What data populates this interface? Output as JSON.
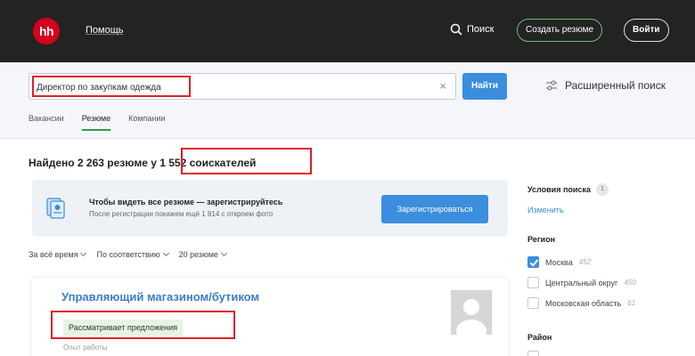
{
  "header": {
    "logo_text": "hh",
    "help_link": "Помощь",
    "search_link": "Поиск",
    "create_resume": "Создать резюме",
    "login": "Войти"
  },
  "search": {
    "query": "Директор по закупкам одежда",
    "find_button": "Найти",
    "advanced": "Расширенный поиск"
  },
  "tabs": [
    {
      "label": "Вакансии",
      "active": false
    },
    {
      "label": "Резюме",
      "active": true
    },
    {
      "label": "Компании",
      "active": false
    }
  ],
  "results": {
    "found_prefix": "Найдено 2 263 резюме у",
    "found_applicants": "1 552 соискателей"
  },
  "banner": {
    "title": "Чтобы видеть все резюме — зарегистрируйтесь",
    "subtitle": "После регистрации покажем ещё 1 814 с откроем фото",
    "button": "Зарегистрироваться"
  },
  "filters": [
    {
      "label": "За всё время"
    },
    {
      "label": "По соответствию"
    },
    {
      "label": "20 резюме"
    }
  ],
  "card": {
    "title": "Управляющий магазином/бутиком",
    "status": "Рассматривает предложения",
    "experience_label": "Опыт работы"
  },
  "sidebar": {
    "conditions_title": "Условия поиска",
    "conditions_count": "1",
    "change_link": "Изменить",
    "region_title": "Регион",
    "regions": [
      {
        "label": "Москва",
        "count": "452",
        "checked": true
      },
      {
        "label": "Центральный округ",
        "count": "450",
        "checked": false
      },
      {
        "label": "Московская область",
        "count": "61",
        "checked": false
      }
    ],
    "district_title": "Район"
  },
  "colors": {
    "brand_red": "#d6001c",
    "top_bar": "#232323",
    "primary_blue": "#3b8ede",
    "annotation_red": "#e31e24",
    "status_green_bg": "#e5f4e3"
  }
}
